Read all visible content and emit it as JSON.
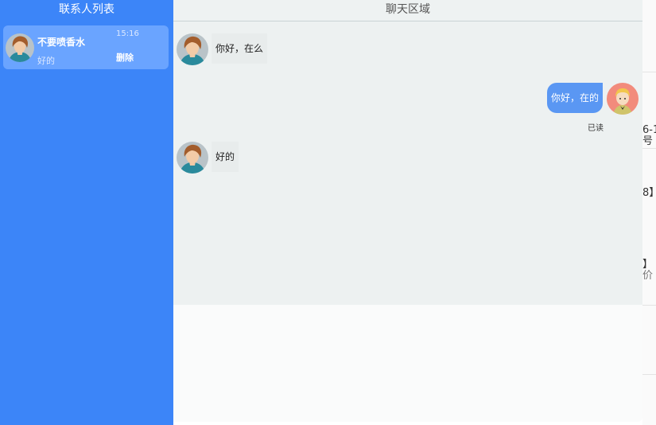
{
  "sidebar": {
    "title": "联系人列表",
    "contacts": [
      {
        "name": "不要喷香水",
        "preview": "好的",
        "time": "15:16",
        "delete_label": "删除"
      }
    ]
  },
  "chat": {
    "title": "聊天区域",
    "messages": [
      {
        "direction": "incoming",
        "text": "你好，在么"
      },
      {
        "direction": "outgoing",
        "text": "你好，在的",
        "status": "已读"
      },
      {
        "direction": "incoming",
        "text": "好的"
      }
    ]
  },
  "background_fragments": [
    "6-1",
    "号",
    "8】",
    "】",
    "价"
  ],
  "colors": {
    "sidebar": "#3c85f8",
    "contact_active": "#6aa4ff",
    "chat_background": "#edf1f1",
    "outgoing_bubble": "#5a97f3"
  },
  "icons": [
    "contact-avatar-icon",
    "user-avatar-icon"
  ]
}
